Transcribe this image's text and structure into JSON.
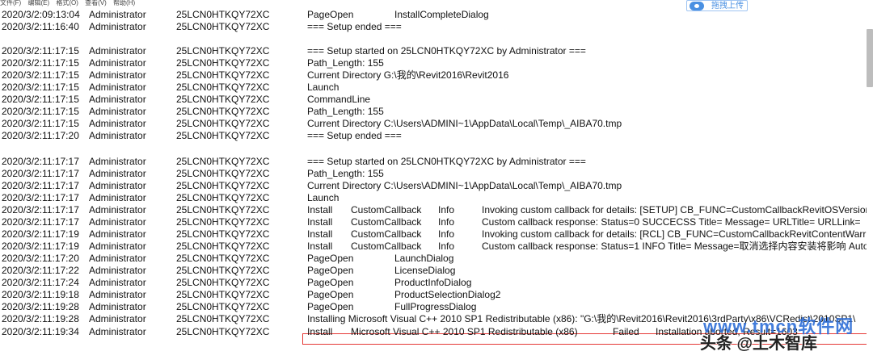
{
  "menu": [
    "文件(F)",
    "编辑(E)",
    "格式(O)",
    "查看(V)",
    "帮助(H)"
  ],
  "upload_button": "拖拽上传",
  "rows": [
    {
      "ts": "2020/3/2:09:13:04",
      "user": "Administrator",
      "host": "25LCN0HTKQY72XC",
      "a": "PageOpen",
      "b2": "InstallCompleteDialog"
    },
    {
      "ts": "2020/3/2:11:16:40",
      "user": "Administrator",
      "host": "25LCN0HTKQY72XC",
      "a": "=== Setup ended ==="
    },
    {
      "ts": "2020/3/2:11:17:15",
      "user": "Administrator",
      "host": "25LCN0HTKQY72XC",
      "a": "=== Setup started on 25LCN0HTKQY72XC by Administrator ==="
    },
    {
      "ts": "2020/3/2:11:17:15",
      "user": "Administrator",
      "host": "25LCN0HTKQY72XC",
      "a": "Path_Length: 155"
    },
    {
      "ts": "2020/3/2:11:17:15",
      "user": "Administrator",
      "host": "25LCN0HTKQY72XC",
      "a": "Current Directory G:\\我的\\Revit2016\\Revit2016"
    },
    {
      "ts": "2020/3/2:11:17:15",
      "user": "Administrator",
      "host": "25LCN0HTKQY72XC",
      "a": "Launch"
    },
    {
      "ts": "2020/3/2:11:17:15",
      "user": "Administrator",
      "host": "25LCN0HTKQY72XC",
      "a": "CommandLine"
    },
    {
      "ts": "2020/3/2:11:17:15",
      "user": "Administrator",
      "host": "25LCN0HTKQY72XC",
      "a": "Path_Length: 155"
    },
    {
      "ts": "2020/3/2:11:17:15",
      "user": "Administrator",
      "host": "25LCN0HTKQY72XC",
      "a": "Current Directory C:\\Users\\ADMINI~1\\AppData\\Local\\Temp\\_AIBA70.tmp"
    },
    {
      "ts": "2020/3/2:11:17:20",
      "user": "Administrator",
      "host": "25LCN0HTKQY72XC",
      "a": "=== Setup ended ==="
    },
    {
      "ts": "2020/3/2:11:17:17",
      "user": "Administrator",
      "host": "25LCN0HTKQY72XC",
      "a": "=== Setup started on 25LCN0HTKQY72XC by Administrator ==="
    },
    {
      "ts": "2020/3/2:11:17:17",
      "user": "Administrator",
      "host": "25LCN0HTKQY72XC",
      "a": "Path_Length: 155"
    },
    {
      "ts": "2020/3/2:11:17:17",
      "user": "Administrator",
      "host": "25LCN0HTKQY72XC",
      "a": "Current Directory C:\\Users\\ADMINI~1\\AppData\\Local\\Temp\\_AIBA70.tmp"
    },
    {
      "ts": "2020/3/2:11:17:17",
      "user": "Administrator",
      "host": "25LCN0HTKQY72XC",
      "a": "Launch"
    },
    {
      "ts": "2020/3/2:11:17:17",
      "user": "Administrator",
      "host": "25LCN0HTKQY72XC",
      "a": "Install",
      "b": "CustomCallback",
      "c": "Info",
      "d": "Invoking custom callback for details: [SETUP] CB_FUNC=CustomCallbackRevitOSVersion"
    },
    {
      "ts": "2020/3/2:11:17:17",
      "user": "Administrator",
      "host": "25LCN0HTKQY72XC",
      "a": "Install",
      "b": "CustomCallback",
      "c": "Info",
      "d": "Custom callback response: Status=0 SUCCECSS Title= Message= URLTitle= URLLink="
    },
    {
      "ts": "2020/3/2:11:17:19",
      "user": "Administrator",
      "host": "25LCN0HTKQY72XC",
      "a": "Install",
      "b": "CustomCallback",
      "c": "Info",
      "d": "Invoking custom callback for details: [RCL] CB_FUNC=CustomCallbackRevitContentWarr"
    },
    {
      "ts": "2020/3/2:11:17:19",
      "user": "Administrator",
      "host": "25LCN0HTKQY72XC",
      "a": "Install",
      "b": "CustomCallback",
      "c": "Info",
      "d": "Custom callback response: Status=1 INFO Title= Message=取消选择内容安装将影响 Auto"
    },
    {
      "ts": "2020/3/2:11:17:20",
      "user": "Administrator",
      "host": "25LCN0HTKQY72XC",
      "a": "PageOpen",
      "b2": "LaunchDialog"
    },
    {
      "ts": "2020/3/2:11:17:22",
      "user": "Administrator",
      "host": "25LCN0HTKQY72XC",
      "a": "PageOpen",
      "b2": "LicenseDialog"
    },
    {
      "ts": "2020/3/2:11:17:24",
      "user": "Administrator",
      "host": "25LCN0HTKQY72XC",
      "a": "PageOpen",
      "b2": "ProductInfoDialog"
    },
    {
      "ts": "2020/3/2:11:19:18",
      "user": "Administrator",
      "host": "25LCN0HTKQY72XC",
      "a": "PageOpen",
      "b2": "ProductSelectionDialog2"
    },
    {
      "ts": "2020/3/2:11:19:28",
      "user": "Administrator",
      "host": "25LCN0HTKQY72XC",
      "a": "PageOpen",
      "b2": "FullProgressDialog"
    },
    {
      "ts": "2020/3/2:11:19:28",
      "user": "Administrator",
      "host": "25LCN0HTKQY72XC",
      "a": "Installing Microsoft Visual C++ 2010 SP1 Redistributable (x86): \"G:\\我的\\Revit2016\\Revit2016\\3rdParty\\x86\\VCRedist\\2010SP1\\"
    },
    {
      "ts": "2020/3/2:11:19:34",
      "user": "Administrator",
      "host": "25LCN0HTKQY72XC",
      "a": "Install",
      "b": "Microsoft Visual C++ 2010 SP1 Redistributable (x86)",
      "status": "Failed",
      "msg": "Installation aborted, Result=1603"
    }
  ],
  "watermark": "www.tmcn软件网",
  "credit": "头条 @土木智库"
}
